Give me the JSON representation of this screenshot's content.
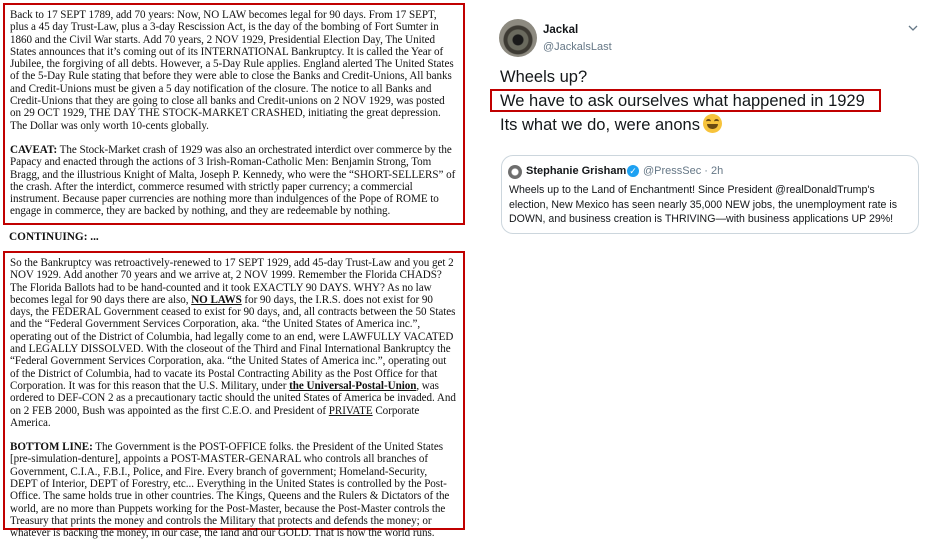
{
  "document": {
    "box1": {
      "p1": "Back to 17 SEPT 1789, add 70 years: Now, NO LAW becomes legal for 90 days. From 17 SEPT, plus a 45 day Trust-Law, plus a 3-day Rescission Act, is the day of the bombing of Fort Sumter in 1860 and the Civil War starts. Add 70 years, 2 NOV 1929, Presidential Election Day, The United States announces that it’s coming out of its INTERNATIONAL Bankruptcy. It is called the Year of Jubilee, the forgiving of all debts. However, a 5-Day Rule applies. England alerted The United States of the 5-Day Rule stating that before they were able to close the Banks and Credit-Unions, All banks and Credit-Unions must be given a 5 day notification of the closure. The notice to all Banks and Credit-Unions that they are going to close all banks and Credit-unions on 2 NOV 1929, was posted on 29 OCT 1929, THE DAY THE STOCK-MARKET CRASHED, initiating the great depression. The Dollar was only worth 10-cents globally.",
      "caveat_label": "CAVEAT:",
      "caveat_text": " The Stock-Market crash of 1929 was also an orchestrated interdict over commerce by the Papacy and enacted through the actions of 3 Irish-Roman-Catholic Men: Benjamin Strong, Tom Bragg, and the illustrious Knight of Malta, Joseph P. Kennedy, who were the “SHORT-SELLERS” of the crash. After the interdict, commerce resumed with strictly paper currency; a commercial instrument. Because paper currencies are nothing more than indulgences of the Pope of ROME to engage in commerce, they are backed by nothing, and they are redeemable by nothing."
    },
    "continuing_label": "CONTINUING: ...",
    "box2": {
      "p1_a": "So the Bankruptcy was retroactively-renewed to 17 SEPT 1929, add 45-day Trust-Law and you get 2 NOV 1929. Add another 70 years and we arrive at, 2 NOV 1999. Remember the Florida CHADS? The Florida Ballots had to be hand-counted and it took EXACTLY 90 DAYS. WHY? As no law becomes legal for 90 days there are also, ",
      "p1_nolaws": "NO LAWS",
      "p1_b": " for 90 days, the I.R.S. does not exist for 90 days, the FEDERAL Government ceased to exist for 90 days, and, all contracts between the 50 States and the “Federal Government Services Corporation, aka. “the United States of America inc.”, operating out of the District of Columbia, had legally come to an end, were LAWFULLY VACATED and LEGALLY DISSOLVED. With the closeout of the Third and Final International Bankruptcy the “Federal Government Services Corporation, aka. “the United States of America inc.”, operating out of the District of Columbia, had to vacate its Postal Contracting Ability as the Post Office for that Corporation. It was for this reason that the U.S. Military, under ",
      "p1_upu": "the Universal-Postal-Union",
      "p1_c": ", was ordered to DEF-CON 2 as a precautionary tactic should the united States of America be invaded. And on 2 FEB 2000, Bush was appointed as the first C.E.O. and President of ",
      "p1_private": "PRIVATE",
      "p1_d": " Corporate America.",
      "bottom_label": "BOTTOM LINE:",
      "bottom_text": " The Government is the POST-OFFICE folks. the President of the United States [pre-simulation-denture], appoints a POST-MASTER-GENARAL who controls all branches of Government, C.I.A., F.B.I., Police, and Fire. Every branch of government; Homeland-Security, DEPT of Interior, DEPT of Forestry, etc... Everything in the United States is controlled by the Post-Office. The same holds true in other countries. The Kings, Queens and the Rulers & Dictators of the world, are no more than Puppets working for the Post-Master, because the Post-Master controls the Treasury that prints the money and controls the Military that protects and defends the money; or whatever is backing the money, in our case, the land and our GOLD. That is how the world runs."
    }
  },
  "tweet": {
    "author_name": "Jackal",
    "author_handle": "@JackalsLast",
    "more_icon": "chevron-down-icon",
    "line1": "Wheels up?",
    "line2": "We have to ask ourselves what happened in 1929",
    "line3": "Its what we do, were anons",
    "emoji": "grinning-squinting-face",
    "quote": {
      "name": "Stephanie Grisham",
      "handle_time": "@PressSec · 2h",
      "body": "Wheels up to the Land of Enchantment! Since President @realDonaldTrump's election, New Mexico has seen nearly 35,000 NEW jobs, the unemployment rate is DOWN, and business creation is THRIVING—with business applications UP 29%!"
    }
  },
  "colors": {
    "highlight_border": "#c00000",
    "twitter_blue": "#1da1f2",
    "muted_text": "#657786"
  }
}
